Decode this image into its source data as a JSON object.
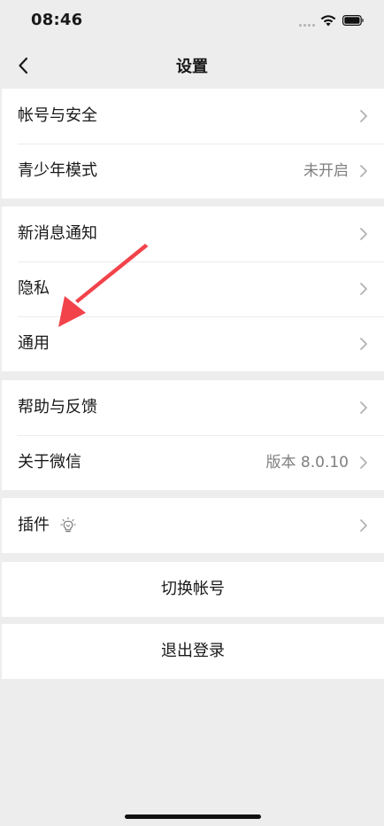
{
  "status_bar": {
    "time": "08:46"
  },
  "nav": {
    "title": "设置"
  },
  "groups": [
    {
      "items": [
        {
          "label": "帐号与安全",
          "value": ""
        },
        {
          "label": "青少年模式",
          "value": "未开启"
        }
      ]
    },
    {
      "items": [
        {
          "label": "新消息通知",
          "value": ""
        },
        {
          "label": "隐私",
          "value": ""
        },
        {
          "label": "通用",
          "value": ""
        }
      ]
    },
    {
      "items": [
        {
          "label": "帮助与反馈",
          "value": ""
        },
        {
          "label": "关于微信",
          "value": "版本 8.0.10"
        }
      ]
    },
    {
      "items": [
        {
          "label": "插件",
          "value": ""
        }
      ]
    }
  ],
  "actions": {
    "switch_account": "切换帐号",
    "logout": "退出登录"
  },
  "colors": {
    "background": "#ededed",
    "annotation_arrow": "#f2434b"
  },
  "icons": [
    "back-arrow-icon",
    "chevron-right-icon",
    "lightbulb-icon",
    "wifi-icon",
    "battery-icon",
    "signal-icon"
  ]
}
